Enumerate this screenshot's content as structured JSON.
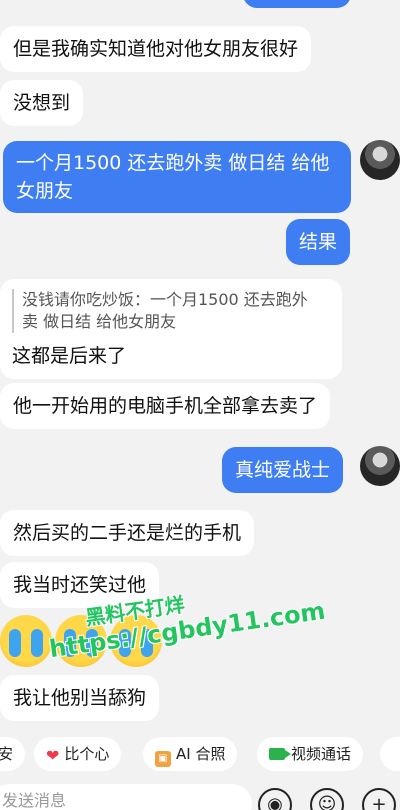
{
  "messages": {
    "m1": "但是我确实知道他对他女朋友很好",
    "m2": "没想到",
    "m3_line1": "一个月1500 还去跑外卖 做日结 给他",
    "m3_line2": "女朋友",
    "m4": "结果",
    "quote_line1": "没钱请你吃炒饭：一个月1500 还去跑外",
    "quote_line2": "卖 做日结 给他女朋友",
    "m5": "这都是后来了",
    "m6": "他一开始用的电脑手机全部拿去卖了",
    "m7": "真纯爱战士",
    "m8": "然后买的二手还是烂的手机",
    "m9": "我当时还笑过他",
    "m10": "我让他别当舔狗"
  },
  "watermark": {
    "line1": "黑料不打烊",
    "line2": "https://cgbdy11.com"
  },
  "quickbar": {
    "chip0": "安",
    "chip1": "比个心",
    "chip2": "AI 合照",
    "chip3": "视频通话"
  },
  "input": {
    "placeholder": "发送消息"
  },
  "colors": {
    "outgoing_bubble": "#3f7df2",
    "incoming_bubble": "#ffffff",
    "background": "#f2f2f2",
    "watermark": "#22c55e"
  }
}
